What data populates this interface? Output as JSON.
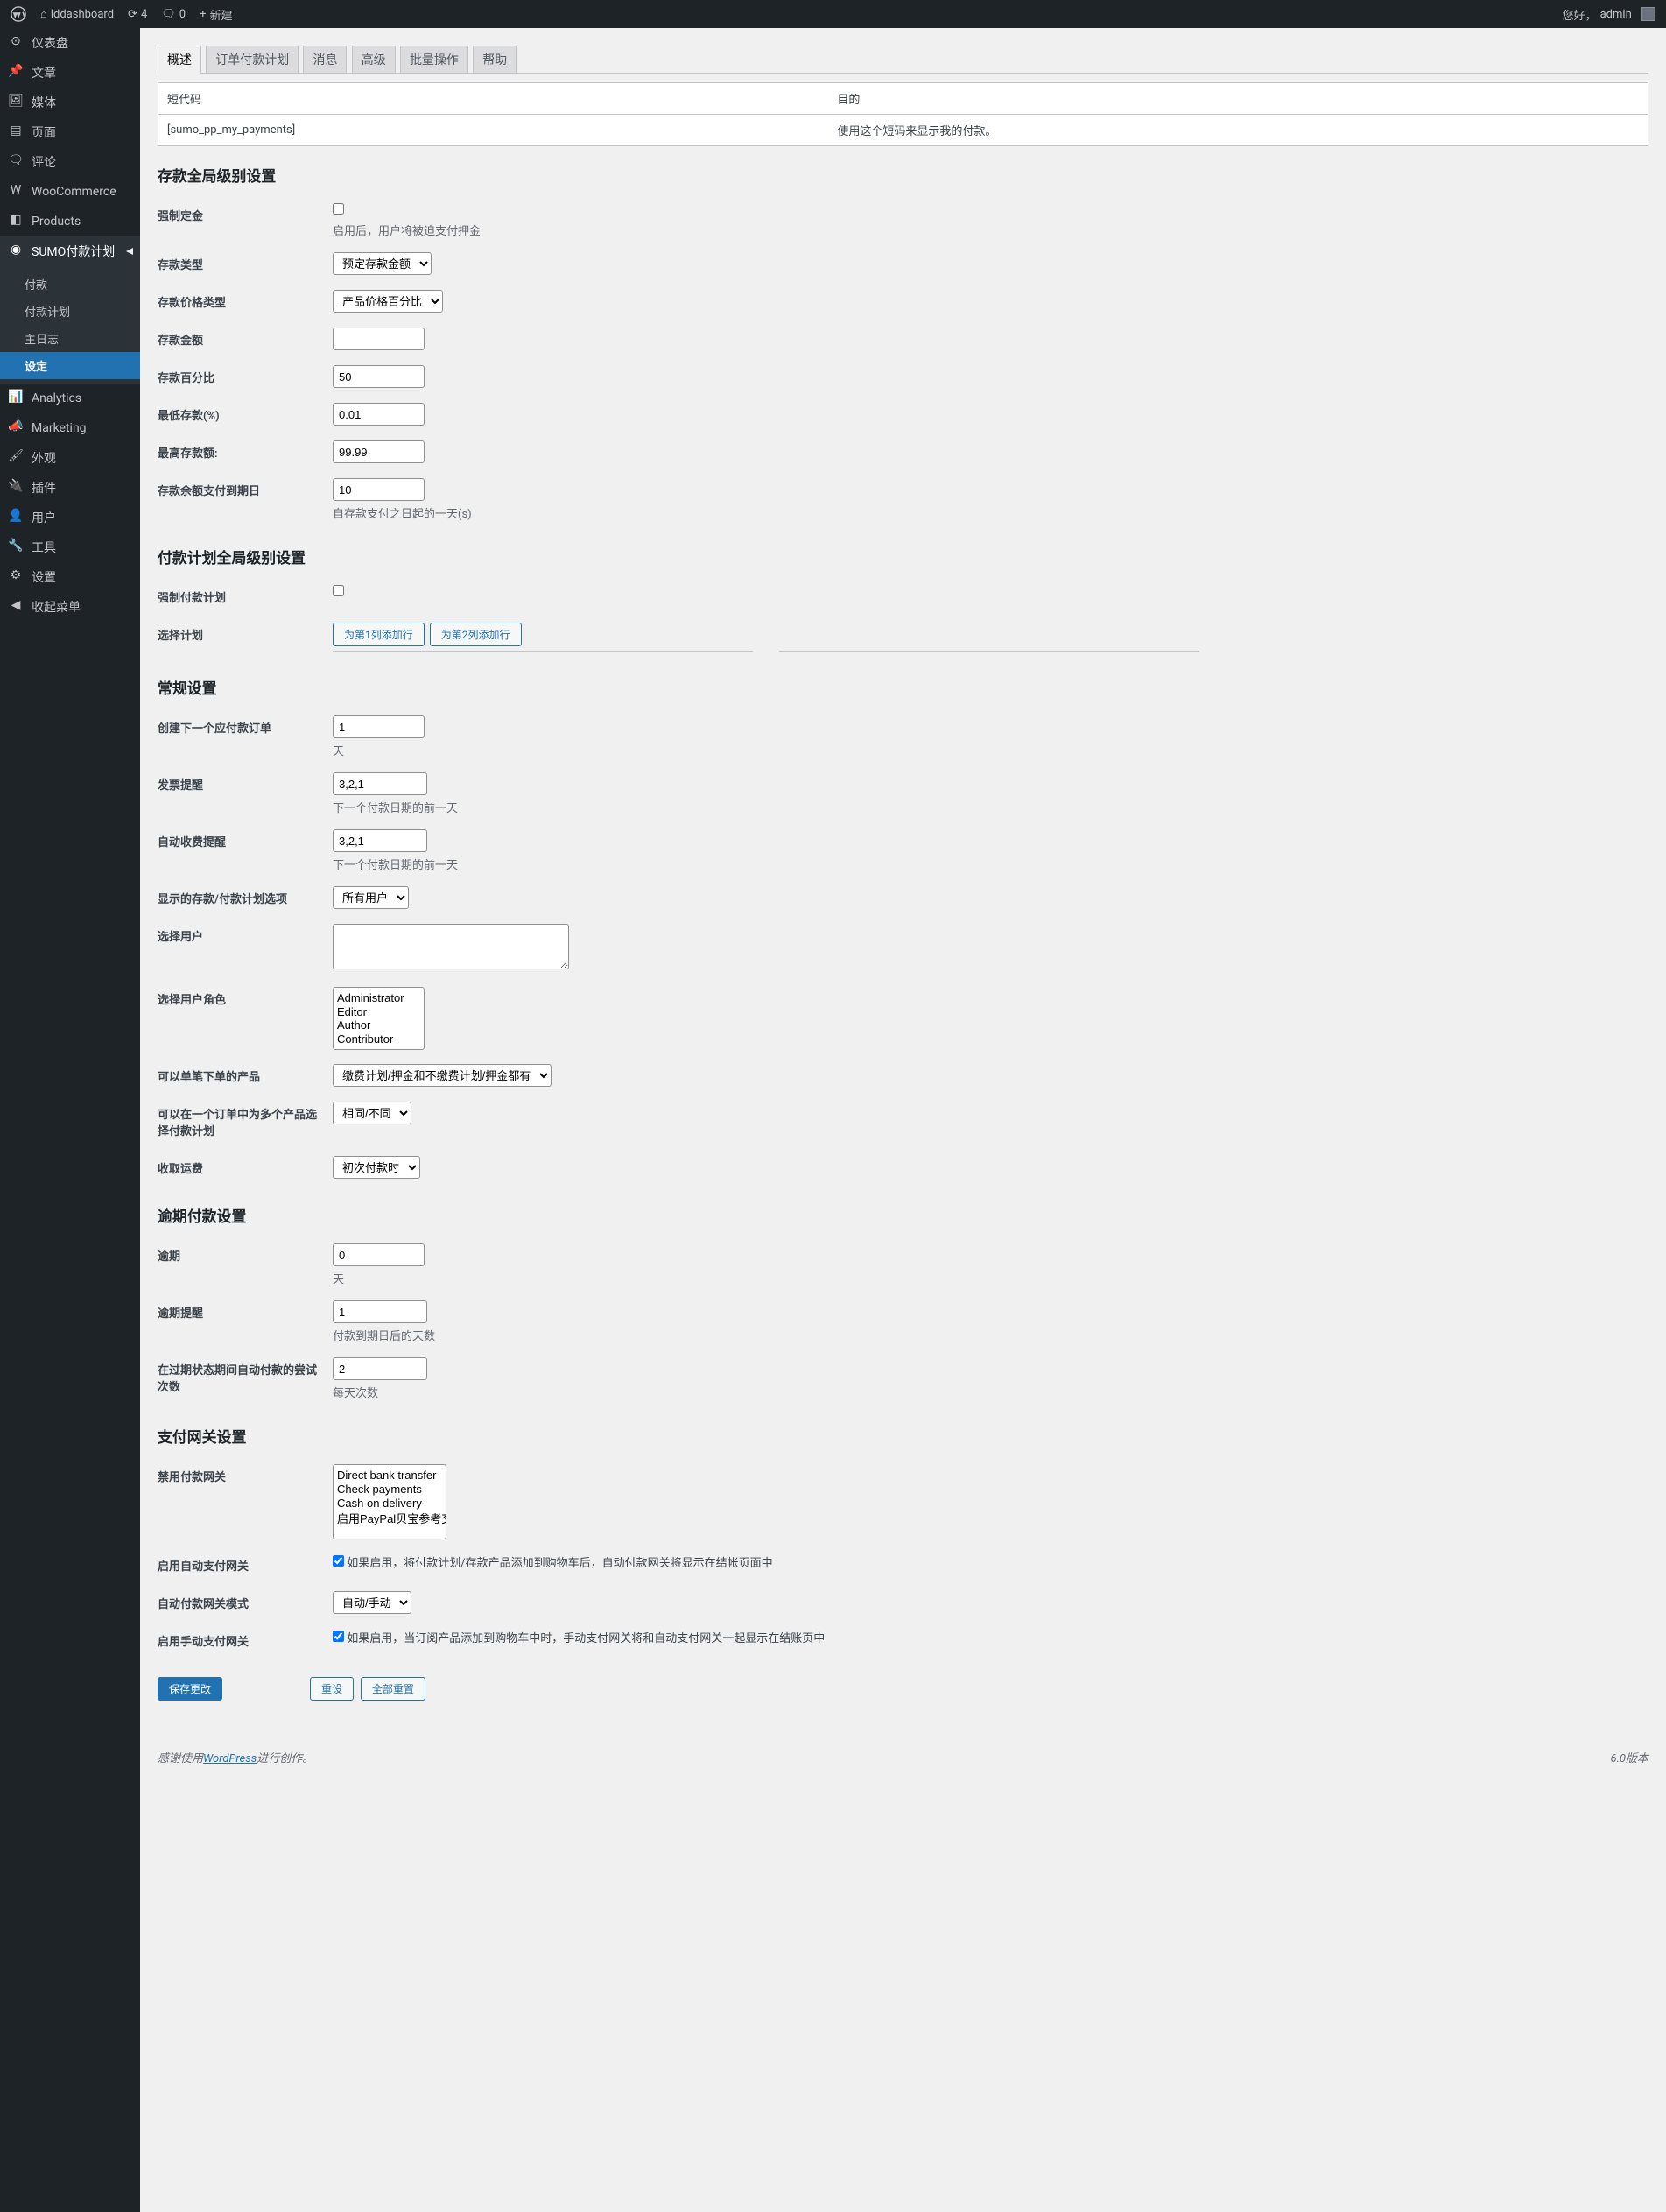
{
  "adminbar": {
    "site": "lddashboard",
    "updates": "4",
    "comments": "0",
    "new": "新建",
    "greeting": "您好，",
    "user": "admin"
  },
  "menu": {
    "dashboard": "仪表盘",
    "posts": "文章",
    "media": "媒体",
    "pages": "页面",
    "comments": "评论",
    "woo": "WooCommerce",
    "products": "Products",
    "sumo": "SUMO付款计划",
    "sumo_sub": {
      "payments": "付款",
      "plans": "付款计划",
      "log": "主日志",
      "settings": "设定"
    },
    "analytics": "Analytics",
    "marketing": "Marketing",
    "appearance": "外观",
    "plugins": "插件",
    "users": "用户",
    "tools": "工具",
    "settings": "设置",
    "collapse": "收起菜单"
  },
  "tabs": {
    "general": "概述",
    "order": "订单付款计划",
    "message": "消息",
    "advanced": "高级",
    "bulk": "批量操作",
    "help": "帮助"
  },
  "shortcode": {
    "h1": "短代码",
    "h2": "目的",
    "code": "[sumo_pp_my_payments]",
    "desc": "使用这个短码来显示我的付款。"
  },
  "deposit": {
    "title": "存款全局级别设置",
    "force": "强制定金",
    "force_desc": "启用后，用户将被迫支付押金",
    "type": "存款类型",
    "type_sel": "预定存款金额",
    "price_type": "存款价格类型",
    "price_type_sel": "产品价格百分比",
    "amount": "存款金额",
    "percent": "存款百分比",
    "percent_v": "50",
    "min": "最低存款(%)",
    "min_v": "0.01",
    "max": "最高存款额:",
    "max_v": "99.99",
    "balance": "存款余额支付到期日",
    "balance_v": "10",
    "balance_desc": "自存款支付之日起的一天(s)"
  },
  "plan": {
    "title": "付款计划全局级别设置",
    "force": "强制付款计划",
    "select": "选择计划",
    "btn1": "为第1列添加行",
    "btn2": "为第2列添加行"
  },
  "general": {
    "title": "常规设置",
    "next": "创建下一个应付款订单",
    "next_v": "1",
    "next_unit": "天",
    "invoice": "发票提醒",
    "invoice_v": "3,2,1",
    "invoice_desc": "下一个付款日期的前一天",
    "auto": "自动收费提醒",
    "auto_v": "3,2,1",
    "auto_desc": "下一个付款日期的前一天",
    "show": "显示的存款/付款计划选项",
    "show_sel": "所有用户",
    "sel_user": "选择用户",
    "sel_role": "选择用户角色",
    "roles": [
      "Administrator",
      "Editor",
      "Author",
      "Contributor"
    ],
    "single": "可以单笔下单的产品",
    "single_sel": "缴费计划/押金和不缴费计划/押金都有",
    "multi": "可以在一个订单中为多个产品选择付款计划",
    "multi_sel": "相同/不同",
    "shipping": "收取运费",
    "shipping_sel": "初次付款时"
  },
  "overdue": {
    "title": "逾期付款设置",
    "over": "逾期",
    "over_v": "0",
    "over_unit": "天",
    "remind": "逾期提醒",
    "remind_v": "1",
    "remind_desc": "付款到期日后的天数",
    "retry": "在过期状态期间自动付款的尝试次数",
    "retry_v": "2",
    "retry_desc": "每天次数"
  },
  "gateway": {
    "title": "支付网关设置",
    "disable": "禁用付款网关",
    "gateways": [
      "Direct bank transfer",
      "Check payments",
      "Cash on delivery",
      "启用PayPal贝宝参考交易"
    ],
    "auto": "启用自动支付网关",
    "auto_desc": "如果启用，将付款计划/存款产品添加到购物车后，自动付款网关将显示在结帐页面中",
    "mode": "自动付款网关模式",
    "mode_sel": "自动/手动",
    "manual": "启用手动支付网关",
    "manual_desc": "如果启用，当订阅产品添加到购物车中时，手动支付网关将和自动支付网关一起显示在结账页中"
  },
  "buttons": {
    "save": "保存更改",
    "reset": "重设",
    "reset_all": "全部重置"
  },
  "footer": {
    "thanks": "感谢使用",
    "wp": "WordPress",
    "create": "进行创作。",
    "version": "6.0版本"
  }
}
